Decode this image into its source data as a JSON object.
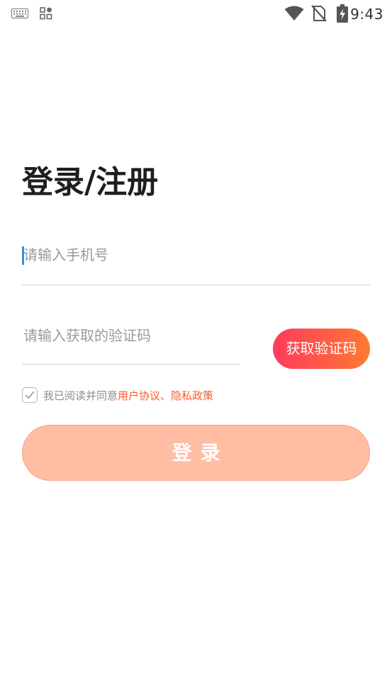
{
  "status_bar": {
    "time": "9:43",
    "icons": [
      "keyboard-icon",
      "apps-grid-icon",
      "wifi-icon",
      "no-sim-icon",
      "battery-charging-icon"
    ]
  },
  "login": {
    "title": "登录/注册",
    "phone_placeholder": "请输入手机号",
    "phone_value": "",
    "code_placeholder": "请输入获取的验证码",
    "code_value": "",
    "get_code_label": "获取验证码",
    "agree_prefix": "我已阅读并同意",
    "agree_links": "用户协议、隐私政策",
    "agree_checked": true,
    "login_label": "登录"
  },
  "colors": {
    "accent": "#ff5a2e",
    "gradient_start": "#ff3b5c",
    "gradient_end": "#ff7a30",
    "login_button": "#ffbda4",
    "cursor": "#2196f3"
  }
}
